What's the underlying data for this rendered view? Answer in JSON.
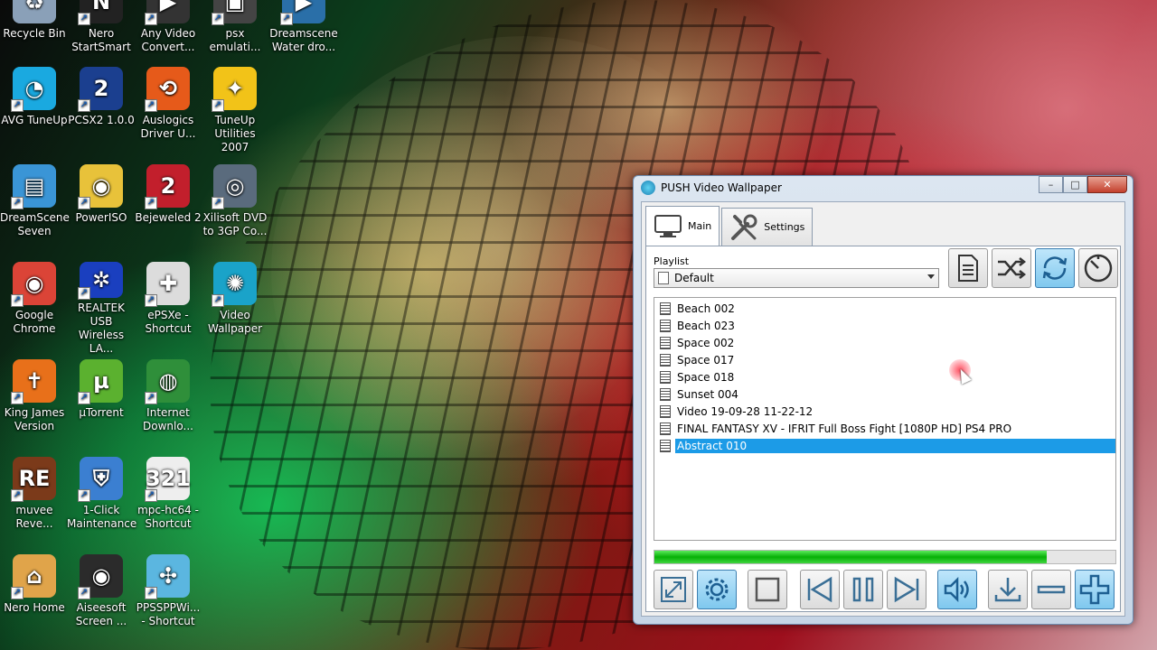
{
  "desktop": {
    "icons": [
      {
        "label": "Recycle Bin",
        "icon": "recycle-bin-icon",
        "color": "#8aa0b8",
        "glyph": "♻"
      },
      {
        "label": "Nero\nStartSmart",
        "icon": "nero-icon",
        "color": "#222222",
        "glyph": "N"
      },
      {
        "label": "Any Video\nConvert...",
        "icon": "any-video-converter-icon",
        "color": "#333333",
        "glyph": "▶"
      },
      {
        "label": "psx\nemulati...",
        "icon": "psx-emulator-icon",
        "color": "#444444",
        "glyph": "▣"
      },
      {
        "label": "Dreamscene\nWater dro...",
        "icon": "dreamscene-water-icon",
        "color": "#2a6fa8",
        "glyph": "▶"
      },
      {
        "label": "AVG TuneUp",
        "icon": "avg-tuneup-icon",
        "color": "#1aa9e0",
        "glyph": "◔"
      },
      {
        "label": "PCSX2 1.0.0",
        "icon": "pcsx2-icon",
        "color": "#1b3f8f",
        "glyph": "2"
      },
      {
        "label": "Auslogics\nDriver U...",
        "icon": "auslogics-icon",
        "color": "#e65a1a",
        "glyph": "⟲"
      },
      {
        "label": "TuneUp\nUtilities 2007",
        "icon": "tuneup-utilities-icon",
        "color": "#f2c318",
        "glyph": "✦"
      },
      {
        "label": "DreamScene\nSeven",
        "icon": "dreamscene-seven-icon",
        "color": "#3a95d6",
        "glyph": "▤"
      },
      {
        "label": "PowerISO",
        "icon": "poweriso-icon",
        "color": "#e8c23a",
        "glyph": "◉"
      },
      {
        "label": "Bejeweled 2",
        "icon": "bejeweled-icon",
        "color": "#c21f2c",
        "glyph": "2"
      },
      {
        "label": "Xilisoft DVD\nto 3GP Co...",
        "icon": "xilisoft-icon",
        "color": "#5a6b7d",
        "glyph": "◎"
      },
      {
        "label": "Google\nChrome",
        "icon": "google-chrome-icon",
        "color": "#db4437",
        "glyph": "◉"
      },
      {
        "label": "REALTEK USB\nWireless LA...",
        "icon": "realtek-icon",
        "color": "#1a3fbf",
        "glyph": "✲"
      },
      {
        "label": "ePSXe -\nShortcut",
        "icon": "epsxe-icon",
        "color": "#dcdcdc",
        "glyph": "✚"
      },
      {
        "label": "Video\nWallpaper",
        "icon": "video-wallpaper-icon",
        "color": "#1aa3c9",
        "glyph": "✺"
      },
      {
        "label": "King James\nVersion",
        "icon": "king-james-icon",
        "color": "#e8701a",
        "glyph": "✝"
      },
      {
        "label": "µTorrent",
        "icon": "utorrent-icon",
        "color": "#5bb12f",
        "glyph": "µ"
      },
      {
        "label": "Internet\nDownlo...",
        "icon": "internet-download-manager-icon",
        "color": "#2f8f3a",
        "glyph": "◍"
      },
      {
        "label": "muvee\nReve...",
        "icon": "muvee-icon",
        "color": "#7b3a1a",
        "glyph": "RE"
      },
      {
        "label": "1-Click\nMaintenance",
        "icon": "one-click-maintenance-icon",
        "color": "#3b7fd1",
        "glyph": "⛨"
      },
      {
        "label": "mpc-hc64 -\nShortcut",
        "icon": "mpc-hc-icon",
        "color": "#eeeeee",
        "glyph": "321"
      },
      {
        "label": "Nero Home",
        "icon": "nero-home-icon",
        "color": "#e0a44a",
        "glyph": "⌂"
      },
      {
        "label": "Aiseesoft\nScreen ...",
        "icon": "aiseesoft-icon",
        "color": "#2b2b2b",
        "glyph": "◉"
      },
      {
        "label": "PPSSPPWi...\n- Shortcut",
        "icon": "ppsspp-icon",
        "color": "#5bb6e0",
        "glyph": "✣"
      }
    ]
  },
  "window": {
    "title": "PUSH Video Wallpaper",
    "title_icon": "push-logo-icon",
    "buttons": {
      "minimize": "–",
      "maximize": "□",
      "close": "✕"
    },
    "tabs": [
      {
        "label": "Main",
        "icon": "monitor-icon"
      },
      {
        "label": "Settings",
        "icon": "wrench-screwdriver-icon"
      }
    ],
    "playlist": {
      "label": "Playlist",
      "selected": "Default",
      "items": [
        "Beach 002",
        "Beach 023",
        "Space 002",
        "Space 017",
        "Space 018",
        "Sunset 004",
        "Video 19-09-28 11-22-12",
        "FINAL FANTASY XV - IFRIT Full Boss Fight [1080P HD] PS4 PRO",
        "Abstract 010"
      ],
      "selected_index": 8
    },
    "toolbar": [
      {
        "icon": "document-icon",
        "active": false
      },
      {
        "icon": "shuffle-icon",
        "active": false
      },
      {
        "icon": "repeat-icon",
        "active": true
      },
      {
        "icon": "timer-icon",
        "active": false
      }
    ],
    "progress": 0.85,
    "controls": [
      {
        "icon": "fullscreen-icon",
        "active": false
      },
      {
        "icon": "gear-icon",
        "active": true
      },
      {
        "icon": "stop-icon",
        "active": false
      },
      {
        "icon": "previous-icon",
        "active": false
      },
      {
        "icon": "pause-icon",
        "active": false
      },
      {
        "icon": "next-icon",
        "active": false
      },
      {
        "icon": "volume-icon",
        "active": true
      },
      {
        "icon": "download-icon",
        "active": false
      },
      {
        "icon": "remove-icon",
        "active": false
      },
      {
        "icon": "add-icon",
        "active": true
      }
    ],
    "colors": {
      "accent": "#1c9be7",
      "progress": "#06b006",
      "active_button": "#7fc8ee"
    }
  }
}
